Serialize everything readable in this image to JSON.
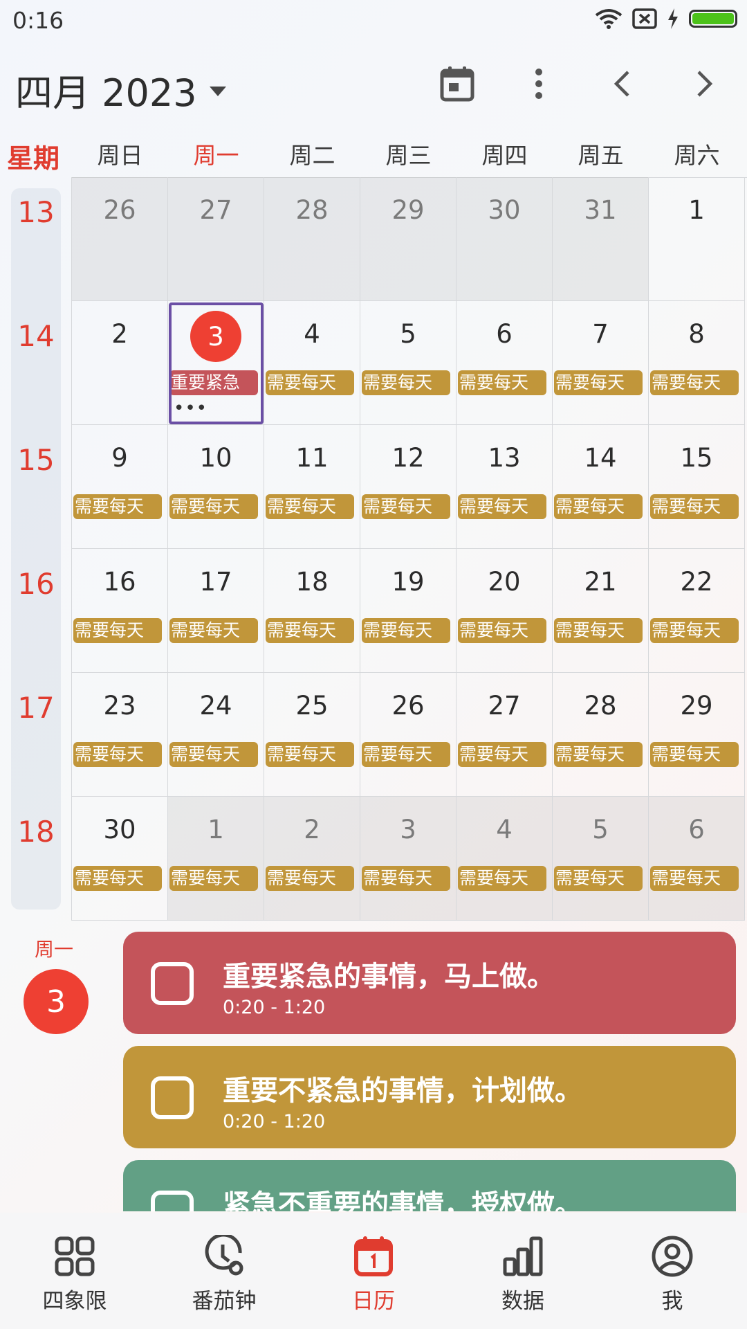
{
  "status_bar": {
    "time": "0:16"
  },
  "header": {
    "month_title": "四月 2023"
  },
  "weekdays": {
    "week_label": "星期",
    "days": [
      "周日",
      "周一",
      "周二",
      "周三",
      "周四",
      "周五",
      "周六"
    ],
    "active_index": 1
  },
  "grid": {
    "week_numbers": [
      "13",
      "14",
      "15",
      "16",
      "17",
      "18"
    ],
    "rows": [
      [
        {
          "d": "26",
          "o": true
        },
        {
          "d": "27",
          "o": true
        },
        {
          "d": "28",
          "o": true
        },
        {
          "d": "29",
          "o": true
        },
        {
          "d": "30",
          "o": true
        },
        {
          "d": "31",
          "o": true
        },
        {
          "d": "1"
        }
      ],
      [
        {
          "d": "2"
        },
        {
          "d": "3",
          "today": true,
          "tag": "重要紧急",
          "tagRed": true,
          "more": "•••"
        },
        {
          "d": "4",
          "tag": "需要每天"
        },
        {
          "d": "5",
          "tag": "需要每天"
        },
        {
          "d": "6",
          "tag": "需要每天"
        },
        {
          "d": "7",
          "tag": "需要每天"
        },
        {
          "d": "8",
          "tag": "需要每天"
        }
      ],
      [
        {
          "d": "9",
          "tag": "需要每天"
        },
        {
          "d": "10",
          "tag": "需要每天"
        },
        {
          "d": "11",
          "tag": "需要每天"
        },
        {
          "d": "12",
          "tag": "需要每天"
        },
        {
          "d": "13",
          "tag": "需要每天"
        },
        {
          "d": "14",
          "tag": "需要每天"
        },
        {
          "d": "15",
          "tag": "需要每天"
        }
      ],
      [
        {
          "d": "16",
          "tag": "需要每天"
        },
        {
          "d": "17",
          "tag": "需要每天"
        },
        {
          "d": "18",
          "tag": "需要每天"
        },
        {
          "d": "19",
          "tag": "需要每天"
        },
        {
          "d": "20",
          "tag": "需要每天"
        },
        {
          "d": "21",
          "tag": "需要每天"
        },
        {
          "d": "22",
          "tag": "需要每天"
        }
      ],
      [
        {
          "d": "23",
          "tag": "需要每天"
        },
        {
          "d": "24",
          "tag": "需要每天"
        },
        {
          "d": "25",
          "tag": "需要每天"
        },
        {
          "d": "26",
          "tag": "需要每天"
        },
        {
          "d": "27",
          "tag": "需要每天"
        },
        {
          "d": "28",
          "tag": "需要每天"
        },
        {
          "d": "29",
          "tag": "需要每天"
        }
      ],
      [
        {
          "d": "30",
          "tag": "需要每天"
        },
        {
          "d": "1",
          "o": true,
          "tag": "需要每天"
        },
        {
          "d": "2",
          "o": true,
          "tag": "需要每天"
        },
        {
          "d": "3",
          "o": true,
          "tag": "需要每天"
        },
        {
          "d": "4",
          "o": true,
          "tag": "需要每天"
        },
        {
          "d": "5",
          "o": true,
          "tag": "需要每天"
        },
        {
          "d": "6",
          "o": true,
          "tag": "需要每天"
        }
      ]
    ]
  },
  "agenda": {
    "weekday": "周一",
    "day": "3",
    "tasks": [
      {
        "title": "重要紧急的事情，马上做。",
        "time": "0:20 - 1:20",
        "color": "#c4545a"
      },
      {
        "title": "重要不紧急的事情，计划做。",
        "time": "0:20 - 1:20",
        "color": "#c1963a"
      },
      {
        "title": "紧急不重要的事情，授权做。",
        "time": "",
        "color": "#62a085"
      }
    ]
  },
  "bottom_nav": {
    "items": [
      {
        "label": "四象限",
        "icon": "grid-icon"
      },
      {
        "label": "番茄钟",
        "icon": "clock-icon"
      },
      {
        "label": "日历",
        "icon": "calendar-icon",
        "active": true
      },
      {
        "label": "数据",
        "icon": "chart-icon"
      },
      {
        "label": "我",
        "icon": "user-icon"
      }
    ]
  },
  "colors": {
    "accent": "#e03c2f",
    "urgent": "#c4545a",
    "daily": "#c1963a",
    "delegate": "#62a085",
    "selection": "#6b4fa5"
  }
}
